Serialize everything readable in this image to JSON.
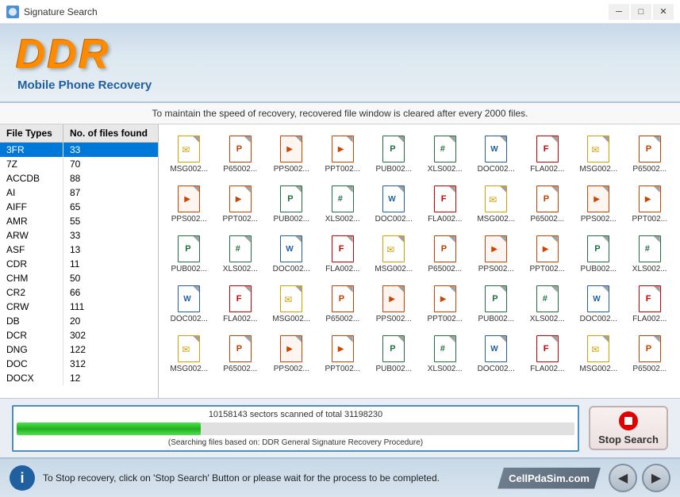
{
  "window": {
    "title": "Signature Search",
    "minimize_label": "─",
    "maximize_label": "□",
    "close_label": "✕"
  },
  "header": {
    "logo": "DDR",
    "subtitle": "Mobile Phone Recovery"
  },
  "info_bar": {
    "text": "To maintain the speed of recovery, recovered file window is cleared after every 2000 files."
  },
  "file_types_panel": {
    "col_type": "File Types",
    "col_count": "No. of files found",
    "items": [
      {
        "type": "3FR",
        "count": "33",
        "selected": true
      },
      {
        "type": "7Z",
        "count": "70"
      },
      {
        "type": "ACCDB",
        "count": "88"
      },
      {
        "type": "AI",
        "count": "87"
      },
      {
        "type": "AIFF",
        "count": "65"
      },
      {
        "type": "AMR",
        "count": "55"
      },
      {
        "type": "ARW",
        "count": "33"
      },
      {
        "type": "ASF",
        "count": "13"
      },
      {
        "type": "CDR",
        "count": "11"
      },
      {
        "type": "CHM",
        "count": "50"
      },
      {
        "type": "CR2",
        "count": "66"
      },
      {
        "type": "CRW",
        "count": "111"
      },
      {
        "type": "DB",
        "count": "20"
      },
      {
        "type": "DCR",
        "count": "302"
      },
      {
        "type": "DNG",
        "count": "122"
      },
      {
        "type": "DOC",
        "count": "312"
      },
      {
        "type": "DOCX",
        "count": "12"
      }
    ]
  },
  "file_grid": {
    "rows": [
      [
        "MSG002...",
        "P65002...",
        "PPS002...",
        "PPT002...",
        "PUB002...",
        "XLS002...",
        "DOC002...",
        "FLA002...",
        "MSG002...",
        "P65002..."
      ],
      [
        "PPS002...",
        "PPT002...",
        "PUB002...",
        "XLS002...",
        "DOC002...",
        "FLA002...",
        "MSG002...",
        "P65002...",
        "PPS002...",
        "PPT002..."
      ],
      [
        "PUB002...",
        "XLS002...",
        "DOC002...",
        "FLA002...",
        "MSG002...",
        "P65002...",
        "PPS002...",
        "PPT002...",
        "PUB002...",
        "XLS002..."
      ],
      [
        "DOC002...",
        "FLA002...",
        "MSG002...",
        "P65002...",
        "PPS002...",
        "PPT002...",
        "PUB002...",
        "XLS002...",
        "DOC002...",
        "FLA002..."
      ],
      [
        "MSG002...",
        "P65002...",
        "PPS002...",
        "PPT002...",
        "PUB002...",
        "XLS002...",
        "DOC002...",
        "FLA002...",
        "MSG002...",
        "P65002..."
      ],
      [
        "",
        "",
        "",
        "",
        "",
        "",
        "",
        "",
        "",
        ""
      ]
    ],
    "icon_types": {
      "MSG": "icon-msg",
      "P65": "icon-p65",
      "PPS": "icon-pps",
      "PPT": "icon-ppt",
      "PUB": "icon-pub",
      "XLS": "icon-xls",
      "DOC": "icon-doc",
      "FLA": "icon-fla"
    }
  },
  "progress": {
    "text": "10158143 sectors scanned of total 31198230",
    "fill_percent": 33,
    "subtext": "(Searching files based on:  DDR General Signature Recovery Procedure)",
    "stop_button_label": "Stop Search"
  },
  "bottom_bar": {
    "info_text": "To Stop recovery, click on 'Stop Search' Button or please wait for the process to be completed.",
    "brand": "CellPdaSim.com",
    "prev_label": "◀",
    "next_label": "▶"
  }
}
